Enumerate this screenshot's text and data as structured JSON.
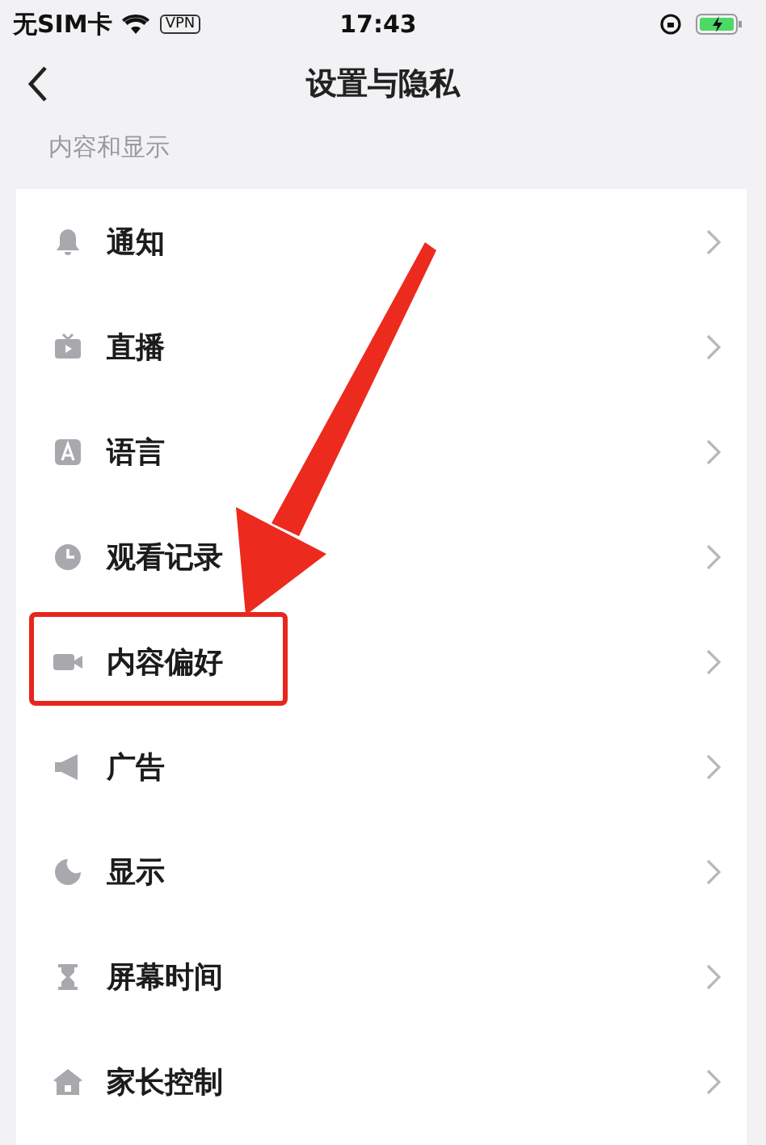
{
  "status_bar": {
    "carrier": "无SIM卡",
    "vpn": "VPN",
    "time": "17:43",
    "charging": true
  },
  "header": {
    "title": "设置与隐私"
  },
  "section": {
    "title": "内容和显示",
    "items": [
      {
        "kind": "bell",
        "label": "通知",
        "highlighted": false
      },
      {
        "kind": "tv",
        "label": "直播",
        "highlighted": false
      },
      {
        "kind": "language",
        "label": "语言",
        "highlighted": false
      },
      {
        "kind": "clock",
        "label": "观看记录",
        "highlighted": false
      },
      {
        "kind": "video",
        "label": "内容偏好",
        "highlighted": true
      },
      {
        "kind": "megaphone",
        "label": "广告",
        "highlighted": false
      },
      {
        "kind": "moon",
        "label": "显示",
        "highlighted": false
      },
      {
        "kind": "hourglass",
        "label": "屏幕时间",
        "highlighted": false
      },
      {
        "kind": "house",
        "label": "家长控制",
        "highlighted": false
      }
    ]
  }
}
